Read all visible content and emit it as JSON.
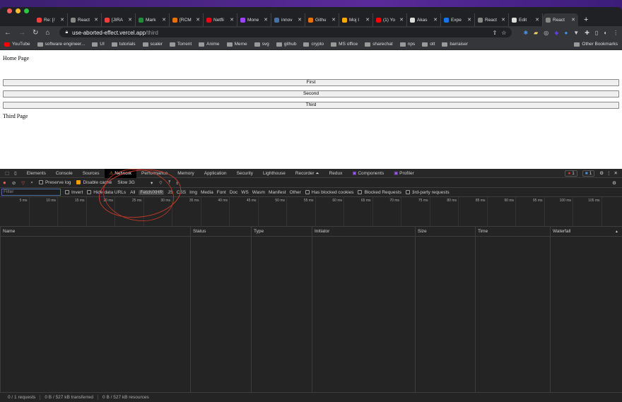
{
  "browser": {
    "tabs": [
      {
        "title": "Re: [/",
        "color": "#ea4335"
      },
      {
        "title": "React",
        "color": "#888"
      },
      {
        "title": "[JIRA",
        "color": "#ea4335"
      },
      {
        "title": "Mark",
        "color": "#1e8e3e"
      },
      {
        "title": "[RCM",
        "color": "#e8710a"
      },
      {
        "title": "Netfli",
        "color": "#e50914"
      },
      {
        "title": "Mone",
        "color": "#a142f4"
      },
      {
        "title": "innov",
        "color": "#4a6fa5"
      },
      {
        "title": "Githu",
        "color": "#e8710a"
      },
      {
        "title": "Moj I",
        "color": "#f9ab00"
      },
      {
        "title": "(1) Yo",
        "color": "#ff0000"
      },
      {
        "title": "Akas",
        "color": "#ddd"
      },
      {
        "title": "Expe",
        "color": "#1a73e8"
      },
      {
        "title": "React",
        "color": "#888"
      },
      {
        "title": "Edit",
        "color": "#ddd"
      },
      {
        "title": "React",
        "color": "#888",
        "active": true
      }
    ],
    "url_host": "use-aborted-effect.vercel.app",
    "url_path": "/third",
    "bookmarks": [
      "YouTube",
      "software engineer...",
      "UI",
      "tutorials",
      "scaler",
      "Torrent",
      "Anime",
      "Meme",
      "svg",
      "github",
      "crypto",
      "MS office",
      "sharechat",
      "nps",
      "ott",
      "barraiser"
    ],
    "other_bookmarks": "Other Bookmarks"
  },
  "page": {
    "home": "Home Page",
    "buttons": [
      "First",
      "Second",
      "Third"
    ],
    "current": "Third Page"
  },
  "devtools": {
    "tabs": [
      "Elements",
      "Console",
      "Sources",
      "Network",
      "Performance",
      "Memory",
      "Application",
      "Security",
      "Lighthouse",
      "Recorder ⏶",
      "Redux",
      "Components",
      "Profiler"
    ],
    "active_tab": "Network",
    "errors": "1",
    "messages": "1",
    "preserve_log": "Preserve log",
    "disable_cache": "Disable cache",
    "throttle": "Slow 3G",
    "filter_placeholder": "Filter",
    "invert": "Invert",
    "hide_data_urls": "Hide data URLs",
    "types": [
      "All",
      "Fetch/XHR",
      "JS",
      "CSS",
      "Img",
      "Media",
      "Font",
      "Doc",
      "WS",
      "Wasm",
      "Manifest",
      "Other"
    ],
    "active_type": "Fetch/XHR",
    "has_blocked": "Has blocked cookies",
    "blocked_requests": "Blocked Requests",
    "third_party": "3rd-party requests",
    "ticks": [
      "5 ms",
      "10 ms",
      "15 ms",
      "20 ms",
      "25 ms",
      "30 ms",
      "35 ms",
      "40 ms",
      "45 ms",
      "50 ms",
      "55 ms",
      "60 ms",
      "65 ms",
      "70 ms",
      "75 ms",
      "80 ms",
      "85 ms",
      "90 ms",
      "95 ms",
      "100 ms",
      "105 ms"
    ],
    "columns": [
      "Name",
      "Status",
      "Type",
      "Initiator",
      "Size",
      "Time",
      "Waterfall"
    ],
    "status": {
      "requests": "0 / 1 requests",
      "transferred": "0 B / 527 kB transferred",
      "resources": "0 B / 527 kB resources"
    }
  }
}
